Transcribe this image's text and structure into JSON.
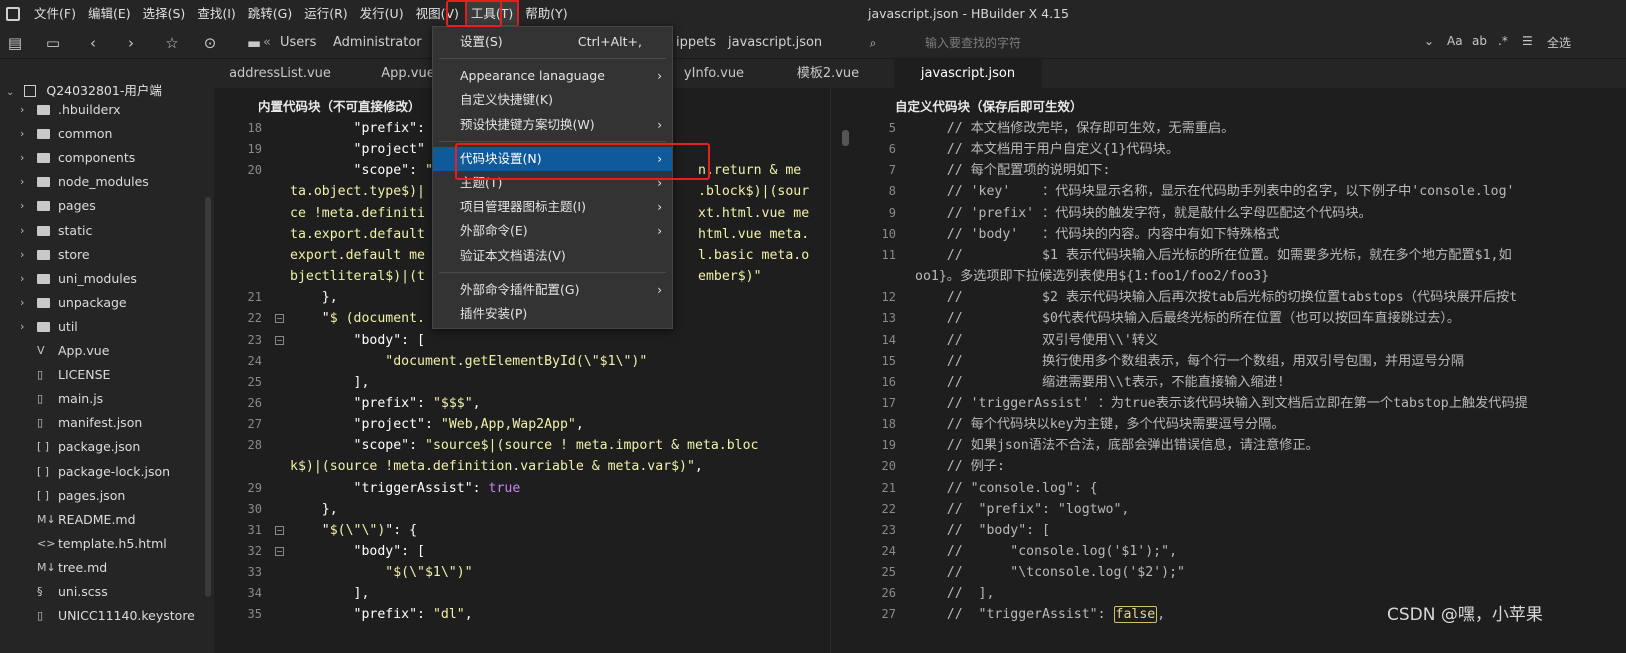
{
  "menubar": {
    "items": [
      "文件(F)",
      "编辑(E)",
      "选择(S)",
      "查找(I)",
      "跳转(G)",
      "运行(R)",
      "发行(U)",
      "视图(V)",
      "工具(T)",
      "帮助(Y)"
    ],
    "active_index": 8
  },
  "window_title": "javascript.json - HBuilder X 4.15",
  "breadcrumb": {
    "sep": "«",
    "items": [
      "Users",
      "Administrator",
      "ippets",
      "javascript.json"
    ]
  },
  "search": {
    "placeholder": "输入要查找的字符"
  },
  "right_tools": {
    "aa": "Aa",
    "more": "全选"
  },
  "project": {
    "name": "Q24032801-用户端",
    "items": [
      {
        "type": "folder",
        "label": ".hbuilderx"
      },
      {
        "type": "folder",
        "label": "common"
      },
      {
        "type": "folder",
        "label": "components"
      },
      {
        "type": "folder",
        "label": "node_modules"
      },
      {
        "type": "folder",
        "label": "pages"
      },
      {
        "type": "folder",
        "label": "static"
      },
      {
        "type": "folder",
        "label": "store"
      },
      {
        "type": "folder",
        "label": "uni_modules"
      },
      {
        "type": "folder",
        "label": "unpackage"
      },
      {
        "type": "folder",
        "label": "util"
      },
      {
        "type": "vue",
        "label": "App.vue"
      },
      {
        "type": "file",
        "label": "LICENSE"
      },
      {
        "type": "file",
        "label": "main.js"
      },
      {
        "type": "file",
        "label": "manifest.json"
      },
      {
        "type": "json",
        "label": "package.json"
      },
      {
        "type": "json",
        "label": "package-lock.json"
      },
      {
        "type": "json",
        "label": "pages.json"
      },
      {
        "type": "md",
        "label": "README.md"
      },
      {
        "type": "html",
        "label": "template.h5.html"
      },
      {
        "type": "md",
        "label": "tree.md"
      },
      {
        "type": "scss",
        "label": "uni.scss"
      },
      {
        "type": "file",
        "label": "UNICC11140.keystore"
      }
    ]
  },
  "tabs": [
    "addressList.vue",
    "App.vue",
    "yInfo.vue",
    "模板2.vue",
    "javascript.json"
  ],
  "active_tab": 4,
  "left_panel": {
    "title": "内置代码块（不可直接修改）",
    "lines": [
      {
        "n": "18",
        "fold": false,
        "segs": [
          [
            "p",
            "        \""
          ],
          [
            "k",
            "prefix"
          ],
          [
            "p",
            "\": "
          ]
        ]
      },
      {
        "n": "19",
        "fold": false,
        "segs": [
          [
            "p",
            "        \""
          ],
          [
            "k",
            "project"
          ],
          [
            "p",
            "\""
          ]
        ]
      },
      {
        "n": "20",
        "fold": false,
        "segs": [
          [
            "p",
            "        \""
          ],
          [
            "k",
            "scope"
          ],
          [
            "p",
            "\": "
          ],
          [
            "s",
            "\""
          ]
        ]
      },
      {
        "n": "",
        "fold": false,
        "segs": [
          [
            "s",
            "ta.object.type$)|"
          ]
        ]
      },
      {
        "n": "",
        "fold": false,
        "segs": [
          [
            "s",
            "ce !meta.definiti"
          ]
        ]
      },
      {
        "n": "",
        "fold": false,
        "segs": [
          [
            "s",
            "ta.export.default"
          ]
        ]
      },
      {
        "n": "",
        "fold": false,
        "segs": [
          [
            "s",
            "export.default me"
          ]
        ]
      },
      {
        "n": "",
        "fold": false,
        "segs": [
          [
            "s",
            "bjectliteral$)|(t"
          ]
        ]
      },
      {
        "n": "21",
        "fold": false,
        "segs": [
          [
            "p",
            "    },"
          ]
        ]
      },
      {
        "n": "22",
        "fold": true,
        "segs": [
          [
            "p",
            "    \""
          ],
          [
            "s",
            "$ (document."
          ]
        ]
      },
      {
        "n": "23",
        "fold": true,
        "segs": [
          [
            "p",
            "        \""
          ],
          [
            "k",
            "body"
          ],
          [
            "p",
            "\": ["
          ]
        ]
      },
      {
        "n": "24",
        "fold": false,
        "segs": [
          [
            "s",
            "            \"document.getElementById(\\\"$1\\\")\""
          ]
        ]
      },
      {
        "n": "25",
        "fold": false,
        "segs": [
          [
            "p",
            "        ],"
          ]
        ]
      },
      {
        "n": "26",
        "fold": false,
        "segs": [
          [
            "p",
            "        \""
          ],
          [
            "k",
            "prefix"
          ],
          [
            "p",
            "\": "
          ],
          [
            "s",
            "\"$$$\""
          ],
          [
            "p",
            ","
          ]
        ]
      },
      {
        "n": "27",
        "fold": false,
        "segs": [
          [
            "p",
            "        \""
          ],
          [
            "k",
            "project"
          ],
          [
            "p",
            "\": "
          ],
          [
            "s",
            "\"Web,App,Wap2App\""
          ],
          [
            "p",
            ","
          ]
        ]
      },
      {
        "n": "28",
        "fold": false,
        "segs": [
          [
            "p",
            "        \""
          ],
          [
            "k",
            "scope"
          ],
          [
            "p",
            "\": "
          ],
          [
            "s",
            "\"source$|(source ! meta.import & meta.bloc"
          ]
        ]
      },
      {
        "n": "",
        "fold": false,
        "segs": [
          [
            "s",
            "k$)|(source !meta.definition.variable & meta.var$)\""
          ],
          [
            "p",
            ","
          ]
        ]
      },
      {
        "n": "29",
        "fold": false,
        "segs": [
          [
            "p",
            "        \""
          ],
          [
            "k",
            "triggerAssist"
          ],
          [
            "p",
            "\": "
          ],
          [
            "b",
            "true"
          ]
        ]
      },
      {
        "n": "30",
        "fold": false,
        "segs": [
          [
            "p",
            "    },"
          ]
        ]
      },
      {
        "n": "31",
        "fold": true,
        "segs": [
          [
            "p",
            "    \""
          ],
          [
            "s",
            "$(\\\"\\\")"
          ],
          [
            "p",
            "\": {"
          ]
        ]
      },
      {
        "n": "32",
        "fold": true,
        "segs": [
          [
            "p",
            "        \""
          ],
          [
            "k",
            "body"
          ],
          [
            "p",
            "\": ["
          ]
        ]
      },
      {
        "n": "33",
        "fold": false,
        "segs": [
          [
            "s",
            "            \"$(\\\"$1\\\")\""
          ]
        ]
      },
      {
        "n": "34",
        "fold": false,
        "segs": [
          [
            "p",
            "        ],"
          ]
        ]
      },
      {
        "n": "35",
        "fold": false,
        "segs": [
          [
            "p",
            "        \""
          ],
          [
            "k",
            "prefix"
          ],
          [
            "p",
            "\": "
          ],
          [
            "s",
            "\"dl\""
          ],
          [
            "p",
            ","
          ]
        ]
      }
    ],
    "right_fragments": [
      [
        "n.return & me",
        ""
      ],
      [
        ".block$)|(sour",
        ""
      ],
      [
        "xt.html.vue me",
        ""
      ],
      [
        "html.vue meta.",
        ""
      ],
      [
        "l.basic meta.o",
        ""
      ],
      [
        "ember$)\"",
        ""
      ]
    ]
  },
  "right_panel": {
    "title": "自定义代码块（保存后即可生效）",
    "lines": [
      {
        "n": "5",
        "t": "    // 本文档修改完毕，保存即可生效，无需重启。"
      },
      {
        "n": "6",
        "t": "    // 本文档用于用户自定义{1}代码块。"
      },
      {
        "n": "7",
        "t": "    // 每个配置项的说明如下:"
      },
      {
        "n": "8",
        "t": "    // 'key'    ：代码块显示名称，显示在代码助手列表中的名字，以下例子中'console.log'"
      },
      {
        "n": "9",
        "t": "    // 'prefix' ：代码块的触发字符，就是敲什么字母匹配这个代码块。"
      },
      {
        "n": "10",
        "t": "    // 'body'   ：代码块的内容。内容中有如下特殊格式"
      },
      {
        "n": "11",
        "t": "    //          $1 表示代码块输入后光标的所在位置。如需要多光标，就在多个地方配置$1,如"
      },
      {
        "n": "",
        "t": "oo1}。多选项即下拉候选列表使用${1:foo1/foo2/foo3}"
      },
      {
        "n": "12",
        "t": "    //          $2 表示代码块输入后再次按tab后光标的切换位置tabstops（代码块展开后按t"
      },
      {
        "n": "13",
        "t": "    //          $0代表代码块输入后最终光标的所在位置（也可以按回车直接跳过去）。"
      },
      {
        "n": "14",
        "t": "    //          双引号使用\\\\'转义"
      },
      {
        "n": "15",
        "t": "    //          换行使用多个数组表示，每个行一个数组，用双引号包围，并用逗号分隔"
      },
      {
        "n": "16",
        "t": "    //          缩进需要用\\\\t表示，不能直接输入缩进!"
      },
      {
        "n": "17",
        "t": "    // 'triggerAssist' ：为true表示该代码块输入到文档后立即在第一个tabstop上触发代码提"
      },
      {
        "n": "18",
        "t": "    // 每个代码块以key为主键，多个代码块需要逗号分隔。"
      },
      {
        "n": "19",
        "t": "    // 如果json语法不合法，底部会弹出错误信息，请注意修正。"
      },
      {
        "n": "20",
        "t": "    // 例子:"
      },
      {
        "n": "21",
        "t": "    // \"console.log\": {"
      },
      {
        "n": "22",
        "t": "    //  \"prefix\": \"logtwo\","
      },
      {
        "n": "23",
        "t": "    //  \"body\": ["
      },
      {
        "n": "24",
        "t": "    //      \"console.log('$1');\","
      },
      {
        "n": "25",
        "t": "    //      \"\\tconsole.log('$2');\""
      },
      {
        "n": "26",
        "t": "    //  ],"
      },
      {
        "n": "27",
        "t": "    //  \"triggerAssist\": "
      }
    ],
    "highlight_word": "false",
    "after_highlight": ","
  },
  "tools_menu": {
    "items": [
      {
        "label": "设置(S)",
        "shortcut": "Ctrl+Alt+,",
        "arrow": false
      },
      {
        "sep": true
      },
      {
        "label": "Appearance lanaguage",
        "arrow": true
      },
      {
        "label": "自定义快捷键(K)",
        "arrow": false
      },
      {
        "label": "预设快捷键方案切换(W)",
        "arrow": true
      },
      {
        "sep": true
      },
      {
        "label": "代码块设置(N)",
        "arrow": true,
        "highlighted": true
      },
      {
        "label": "主题(T)",
        "arrow": true
      },
      {
        "label": "项目管理器图标主题(I)",
        "arrow": true
      },
      {
        "label": "外部命令(E)",
        "arrow": true
      },
      {
        "label": "验证本文档语法(V)",
        "arrow": false
      },
      {
        "sep": true
      },
      {
        "label": "外部命令插件配置(G)",
        "arrow": true
      },
      {
        "label": "插件安装(P)",
        "arrow": false
      }
    ]
  },
  "watermark": "CSDN @嘿，小苹果",
  "colors": {
    "accent": "#0e5a9b",
    "annotation_red": "#e62020"
  }
}
